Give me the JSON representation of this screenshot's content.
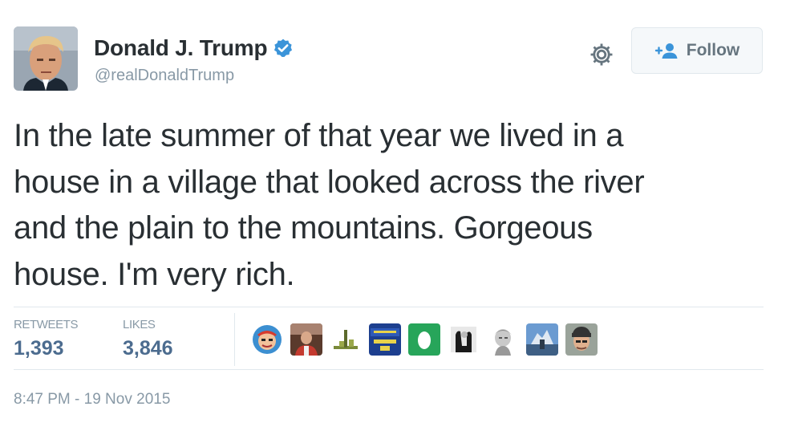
{
  "author": {
    "name": "Donald J. Trump",
    "handle": "@realDonaldTrump",
    "verified": true,
    "verified_color": "#3b94d9"
  },
  "actions": {
    "follow_label": "Follow",
    "settings_icon": "gear-icon"
  },
  "tweet": {
    "lines": [
      "In the late summer of that year we lived in a",
      "house in a village that looked across the river",
      "and the plain to the mountains. Gorgeous",
      "house. I'm very rich."
    ]
  },
  "stats": {
    "retweets_label": "RETWEETS",
    "retweets_count": "1,393",
    "likes_label": "LIKES",
    "likes_count": "3,846"
  },
  "likers": [
    {
      "icon": "avatar-cartoon-face"
    },
    {
      "icon": "avatar-red-shirt-person"
    },
    {
      "icon": "avatar-green-shape"
    },
    {
      "icon": "avatar-blue-sign"
    },
    {
      "icon": "avatar-green-egg"
    },
    {
      "icon": "avatar-black-white-figure"
    },
    {
      "icon": "avatar-gray-sketch"
    },
    {
      "icon": "avatar-blue-building"
    },
    {
      "icon": "avatar-man-with-cap"
    }
  ],
  "timestamp": "8:47 PM - 19 Nov 2015",
  "colors": {
    "text": "#292f33",
    "secondary": "#8899a6",
    "count": "#4c6c8f",
    "accent": "#3b94d9"
  }
}
